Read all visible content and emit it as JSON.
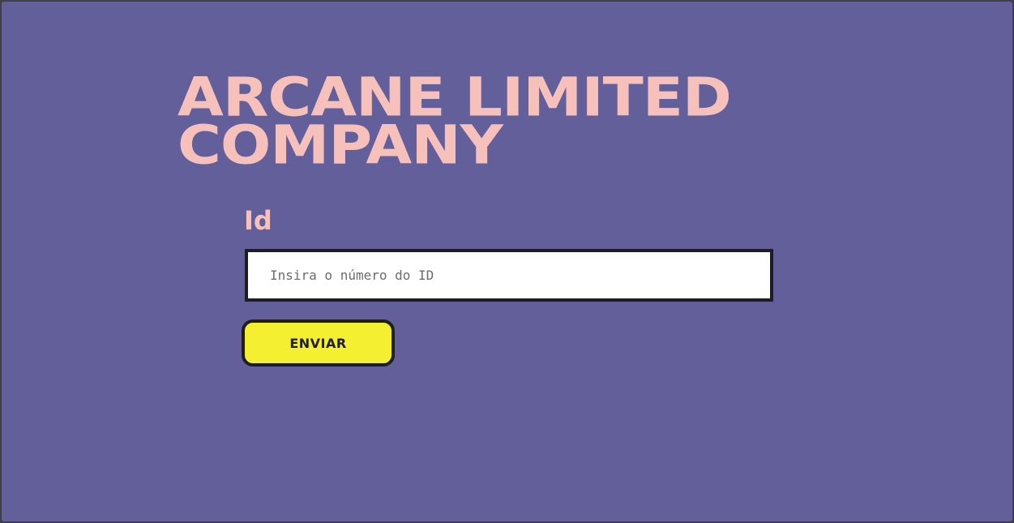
{
  "header": {
    "title_line1": "ARCANE LIMITED",
    "title_line2": "COMPANY"
  },
  "form": {
    "id_label": "Id",
    "id_input": {
      "value": "",
      "placeholder": "Insira o número do ID"
    },
    "submit_label": "ENVIAR"
  },
  "colors": {
    "background": "#635f9a",
    "title": "#f7c1bb",
    "button": "#f5ef31",
    "border": "#1e1e22"
  }
}
